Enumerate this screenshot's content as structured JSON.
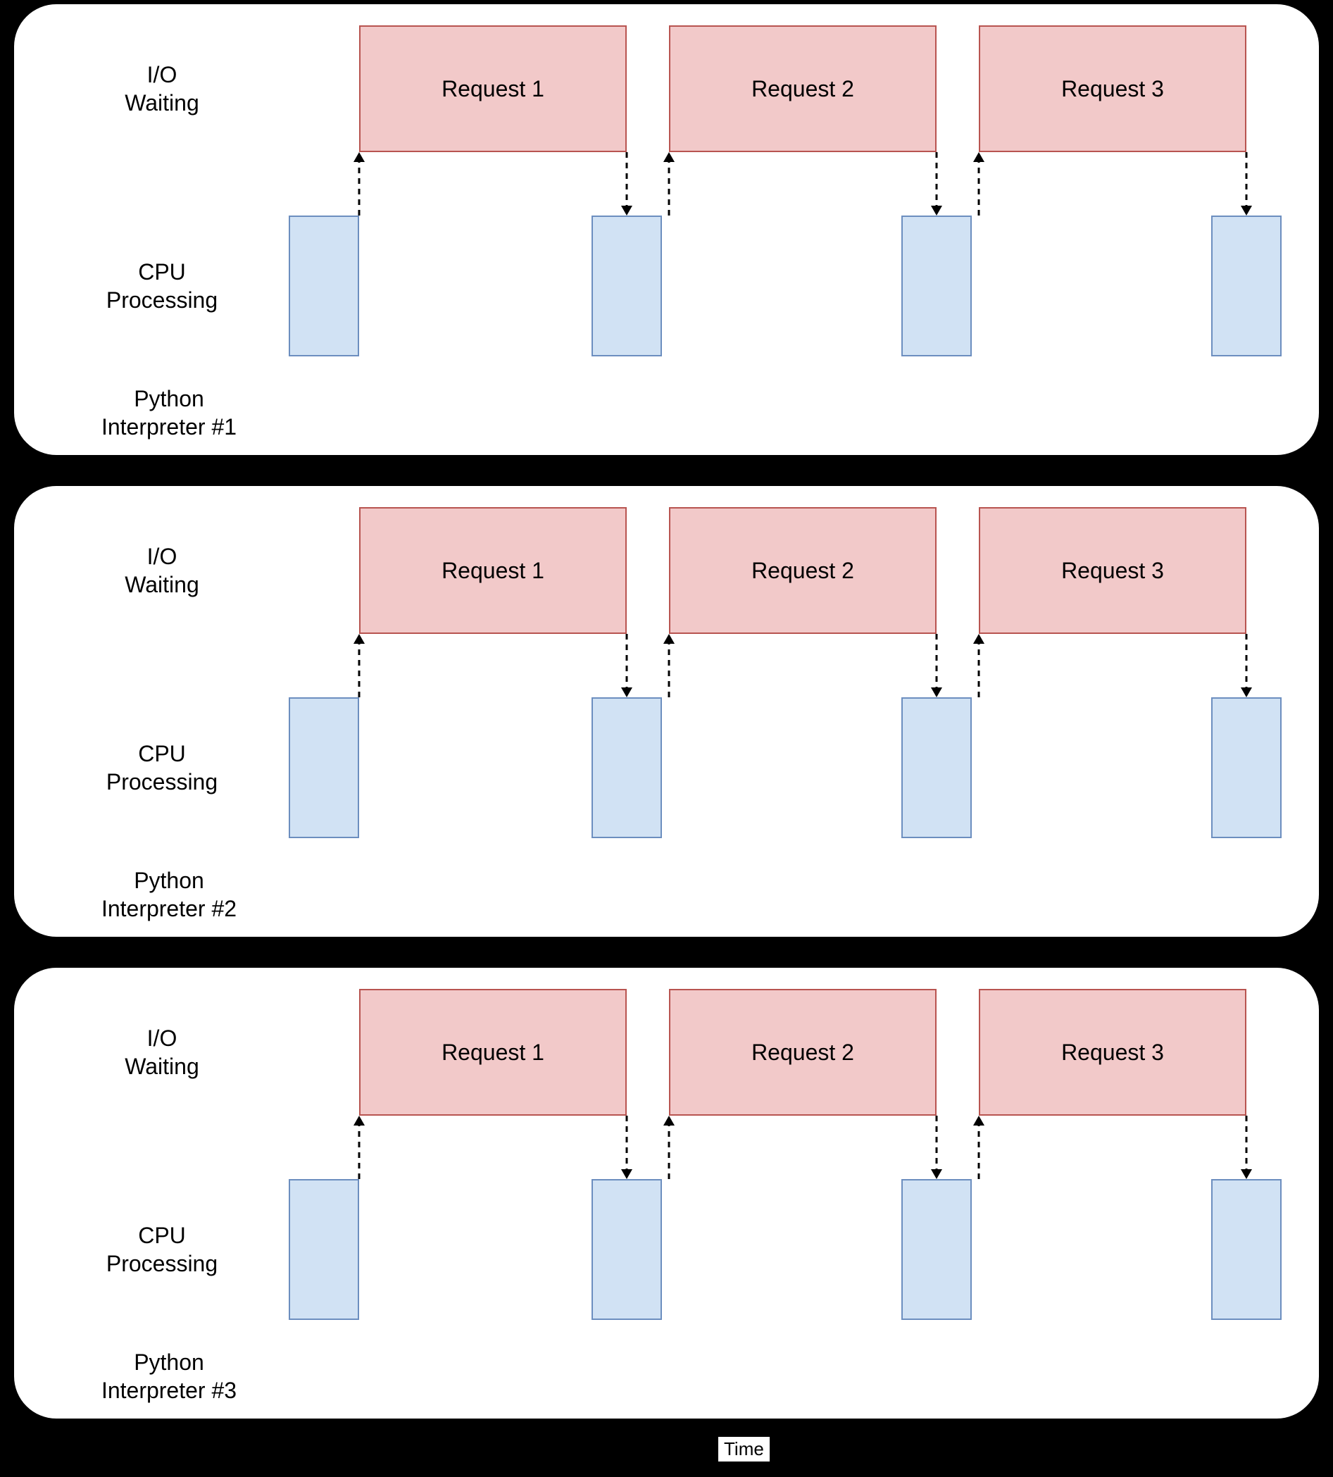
{
  "diagram": {
    "panels": [
      {
        "id": "panel-1",
        "ioWaitingLabel": "I/O\nWaiting",
        "cpuProcessingLabel": "CPU\nProcessing",
        "interpreterLabel": "Python\nInterpreter #1",
        "requests": [
          "Request 1",
          "Request 2",
          "Request 3"
        ]
      },
      {
        "id": "panel-2",
        "ioWaitingLabel": "I/O\nWaiting",
        "cpuProcessingLabel": "CPU\nProcessing",
        "interpreterLabel": "Python\nInterpreter #2",
        "requests": [
          "Request 1",
          "Request 2",
          "Request 3"
        ]
      },
      {
        "id": "panel-3",
        "ioWaitingLabel": "I/O\nWaiting",
        "cpuProcessingLabel": "CPU\nProcessing",
        "interpreterLabel": "Python\nInterpreter #3",
        "requests": [
          "Request 1",
          "Request 2",
          "Request 3"
        ]
      }
    ],
    "timeLabel": "Time",
    "colors": {
      "requestFill": "#f2c9c9",
      "requestStroke": "#b85450",
      "cpuFill": "#d1e2f4",
      "cpuStroke": "#6c8ebf",
      "panelBg": "#ffffff",
      "pageBg": "#000000"
    },
    "layout": {
      "panelTops": [
        6,
        690,
        1374
      ],
      "panelHeight": 640,
      "reqTop": 30,
      "reqHeight": 180,
      "reqWidth": 380,
      "reqLefts": [
        490,
        930,
        1370
      ],
      "cpuTop": 300,
      "cpuHeight": 200,
      "cpuWidth": 100,
      "cpuLefts": [
        390,
        820,
        1260,
        1700
      ],
      "ioLabelTop": 80,
      "ioLabelLeft": 120,
      "cpuLabelTop": 360,
      "cpuLabelLeft": 110,
      "interpLabelTop": 540,
      "interpLabelLeft": 100
    }
  }
}
